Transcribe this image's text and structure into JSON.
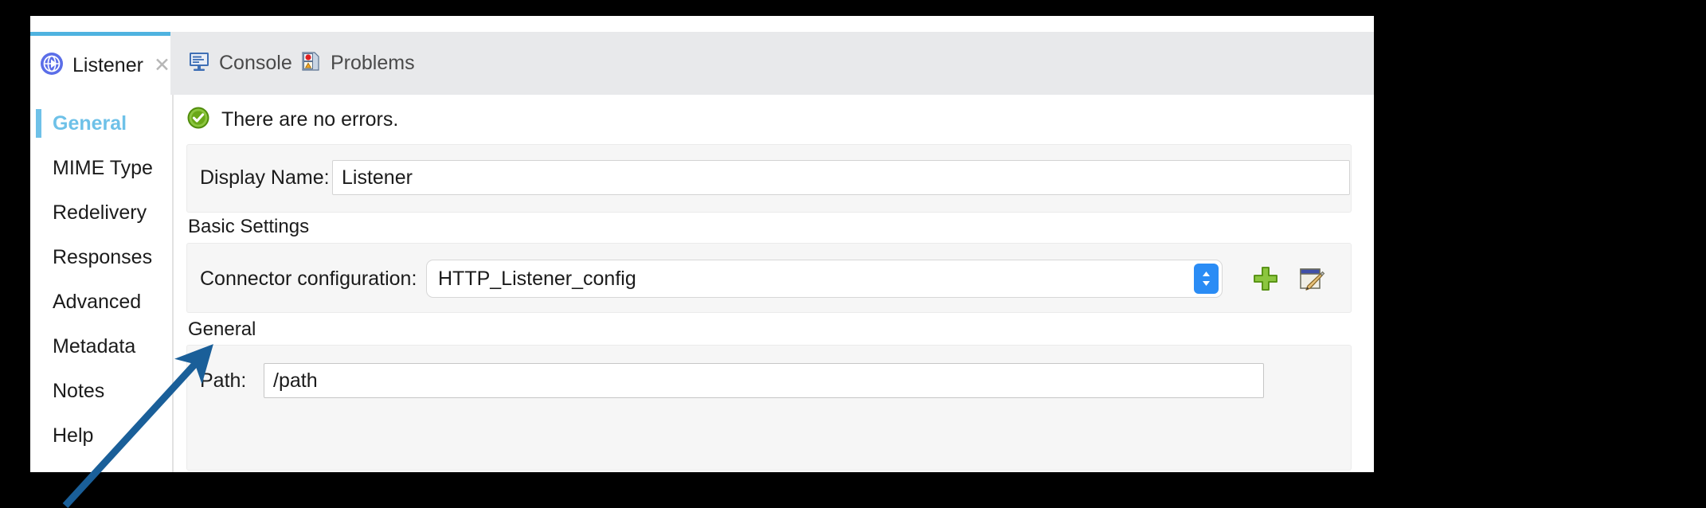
{
  "colors": {
    "accent_blue": "#6ec1e8",
    "tab_active_border": "#4fb3e0",
    "combo_button_blue": "#2a8cf5",
    "add_icon_green": "#7cb82f",
    "status_ok_green": "#6aa818",
    "annotation_arrow": "#1a5f99",
    "panel_background": "#ffffff",
    "tabbar_background": "#e8e9eb",
    "groupbox_background": "#f6f6f6"
  },
  "tabs": [
    {
      "label": "Listener",
      "icon": "globe-arrow-icon",
      "active": true,
      "closable": true,
      "close_glyph": "✕"
    },
    {
      "label": "Console",
      "icon": "console-monitor-icon",
      "active": false,
      "closable": false
    },
    {
      "label": "Problems",
      "icon": "problems-page-icon",
      "active": false,
      "closable": false
    }
  ],
  "sidebar": {
    "items": [
      {
        "label": "General",
        "active": true
      },
      {
        "label": "MIME Type",
        "active": false
      },
      {
        "label": "Redelivery",
        "active": false
      },
      {
        "label": "Responses",
        "active": false
      },
      {
        "label": "Advanced",
        "active": false
      },
      {
        "label": "Metadata",
        "active": false
      },
      {
        "label": "Notes",
        "active": false
      },
      {
        "label": "Help",
        "active": false
      }
    ]
  },
  "content": {
    "status": {
      "icon": "check-circle-icon",
      "text": "There are no errors."
    },
    "display_name": {
      "label": "Display Name:",
      "value": "Listener",
      "placeholder": ""
    },
    "basic_settings": {
      "title": "Basic Settings",
      "connector": {
        "label": "Connector configuration:",
        "value": "HTTP_Listener_config",
        "placeholder": "",
        "dropdown_icon": "chevron-up-down-icon",
        "add_icon": "plus-add-icon",
        "edit_icon": "edit-pencil-icon"
      }
    },
    "general": {
      "title": "General",
      "path": {
        "label": "Path:",
        "value": "/path",
        "placeholder": ""
      }
    }
  },
  "annotation": {
    "arrow_icon": "pointer-arrow-icon"
  }
}
